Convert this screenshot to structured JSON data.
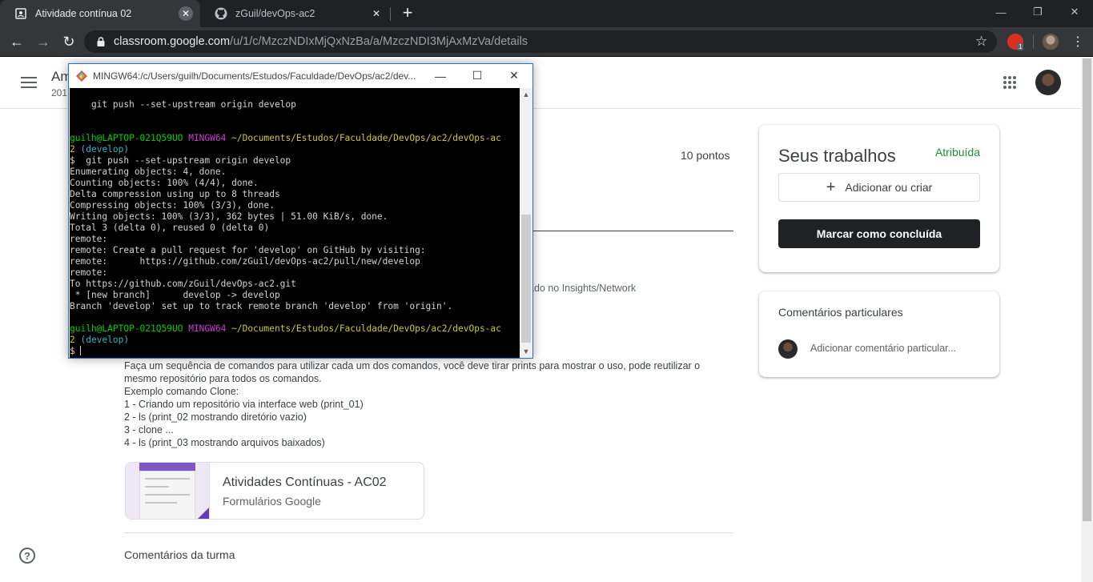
{
  "browser": {
    "tabs": [
      {
        "title": "Atividade contínua 02",
        "active": true,
        "icon": "classroom-assignment-icon"
      },
      {
        "title": "zGuil/devOps-ac2",
        "active": false,
        "icon": "github-icon"
      }
    ],
    "url_host": "classroom.google.com",
    "url_path": "/u/1/c/MzczNDIxMjQxNzBa/a/MzczNDI3MjAxMzVa/details",
    "extension_badge": "1"
  },
  "classroom": {
    "course_title_partial": "Am",
    "course_sub_partial": "201",
    "points": "10 pontos",
    "partial_visible_text": "ado no Insights/Network",
    "description": [
      "Faça um sequência de comandos para utilizar cada um dos comandos, você deve tirar prints para mostrar o uso, pode reutilizar o",
      "mesmo repositório para todos os comandos.",
      "Exemplo comando Clone:",
      "1 - Criando um repositório via interface web (print_01)",
      "2 - ls (print_02 mostrando diretório vazio)",
      "3 - clone ...",
      "4 - ls (print_03 mostrando arquivos baixados)"
    ],
    "attachment": {
      "title": "Atividades Contínuas - AC02",
      "subtitle": "Formulários Google"
    },
    "class_comments": "Comentários da turma",
    "your_work": {
      "title": "Seus trabalhos",
      "status": "Atribuída",
      "add_label": "Adicionar ou criar",
      "done_label": "Marcar como concluída"
    },
    "private_comments": {
      "title": "Comentários particulares",
      "placeholder": "Adicionar comentário particular..."
    }
  },
  "terminal": {
    "title": "MINGW64:/c/Users/guilh/Documents/Estudos/Faculdade/DevOps/ac2/dev...",
    "prompt_user": "guilh@LAPTOP-021Q59UO",
    "prompt_env": "MINGW64",
    "prompt_path": "~/Documents/Estudos/Faculdade/DevOps/ac2/devOps-ac",
    "prompt_path_wrap": "2",
    "prompt_branch": "(develop)",
    "lines": {
      "top": "    git push --set-upstream origin develop",
      "cmd": "$  git push --set-upstream origin develop",
      "out": [
        "Enumerating objects: 4, done.",
        "Counting objects: 100% (4/4), done.",
        "Delta compression using up to 8 threads",
        "Compressing objects: 100% (3/3), done.",
        "Writing objects: 100% (3/3), 362 bytes | 51.00 KiB/s, done.",
        "Total 3 (delta 0), reused 0 (delta 0)",
        "remote:",
        "remote: Create a pull request for 'develop' on GitHub by visiting:",
        "remote:      https://github.com/zGuil/devOps-ac2/pull/new/develop",
        "remote:",
        "To https://github.com/zGuil/devOps-ac2.git",
        " * [new branch]      develop -> develop",
        "Branch 'develop' set up to track remote branch 'develop' from 'origin'."
      ],
      "final_prompt": "$ "
    }
  }
}
